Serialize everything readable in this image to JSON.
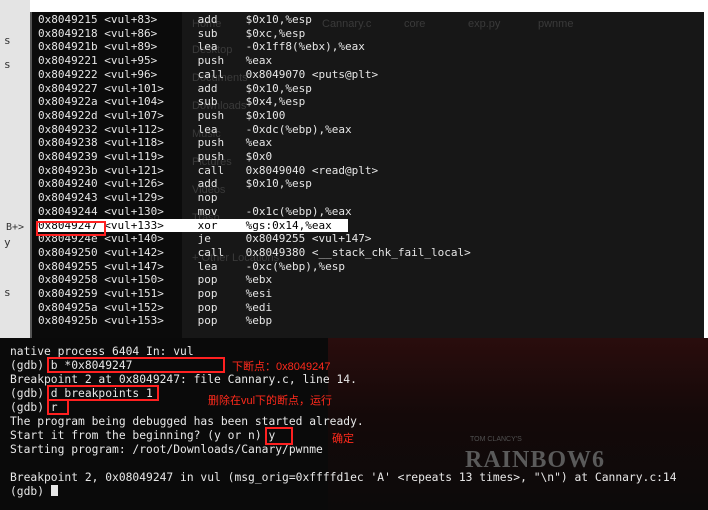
{
  "left_strip": [
    "s",
    "s",
    "y",
    "s"
  ],
  "asm": {
    "breakpoint_marker": "B+>",
    "lines": [
      {
        "addr": "0x8049215",
        "off": "<vul+83>",
        "op": "add",
        "args": "$0x10,%esp"
      },
      {
        "addr": "0x8049218",
        "off": "<vul+86>",
        "op": "sub",
        "args": "$0xc,%esp"
      },
      {
        "addr": "0x804921b",
        "off": "<vul+89>",
        "op": "lea",
        "args": "-0x1ff8(%ebx),%eax"
      },
      {
        "addr": "0x8049221",
        "off": "<vul+95>",
        "op": "push",
        "args": "%eax"
      },
      {
        "addr": "0x8049222",
        "off": "<vul+96>",
        "op": "call",
        "args": "0x8049070 <puts@plt>"
      },
      {
        "addr": "0x8049227",
        "off": "<vul+101>",
        "op": "add",
        "args": "$0x10,%esp"
      },
      {
        "addr": "0x804922a",
        "off": "<vul+104>",
        "op": "sub",
        "args": "$0x4,%esp"
      },
      {
        "addr": "0x804922d",
        "off": "<vul+107>",
        "op": "push",
        "args": "$0x100"
      },
      {
        "addr": "0x8049232",
        "off": "<vul+112>",
        "op": "lea",
        "args": "-0xdc(%ebp),%eax"
      },
      {
        "addr": "0x8049238",
        "off": "<vul+118>",
        "op": "push",
        "args": "%eax"
      },
      {
        "addr": "0x8049239",
        "off": "<vul+119>",
        "op": "push",
        "args": "$0x0"
      },
      {
        "addr": "0x804923b",
        "off": "<vul+121>",
        "op": "call",
        "args": "0x8049040 <read@plt>"
      },
      {
        "addr": "0x8049240",
        "off": "<vul+126>",
        "op": "add",
        "args": "$0x10,%esp"
      },
      {
        "addr": "0x8049243",
        "off": "<vul+129>",
        "op": "nop",
        "args": ""
      },
      {
        "addr": "0x8049244",
        "off": "<vul+130>",
        "op": "mov",
        "args": "-0x1c(%ebp),%eax"
      },
      {
        "addr": "0x8049247",
        "off": "<vul+133>",
        "op": "xor",
        "args": "%gs:0x14,%eax"
      },
      {
        "addr": "0x804924e",
        "off": "<vul+140>",
        "op": "je",
        "args": "0x8049255 <vul+147>"
      },
      {
        "addr": "0x8049250",
        "off": "<vul+142>",
        "op": "call",
        "args": "0x8049380 <__stack_chk_fail_local>"
      },
      {
        "addr": "0x8049255",
        "off": "<vul+147>",
        "op": "lea",
        "args": "-0xc(%ebp),%esp"
      },
      {
        "addr": "0x8049258",
        "off": "<vul+150>",
        "op": "pop",
        "args": "%ebx"
      },
      {
        "addr": "0x8049259",
        "off": "<vul+151>",
        "op": "pop",
        "args": "%esi"
      },
      {
        "addr": "0x804925a",
        "off": "<vul+152>",
        "op": "pop",
        "args": "%edi"
      },
      {
        "addr": "0x804925b",
        "off": "<vul+153>",
        "op": "pop",
        "args": "%ebp"
      }
    ]
  },
  "ghost_desktop": {
    "files": [
      "Cannary.c",
      "core",
      "exp.py",
      "pwnme"
    ],
    "sidebar": [
      "Home",
      "Desktop",
      "Documents",
      "Downloads",
      "Music",
      "Pictures",
      "Videos",
      "Trash",
      "+ Other Locations"
    ]
  },
  "terminal": {
    "lines": [
      "native process 6404 In: vul",
      "(gdb) b *0x8049247",
      "Breakpoint 2 at 0x8049247: file Cannary.c, line 14.",
      "(gdb) d breakpoints 1",
      "(gdb) r",
      "The program being debugged has been started already.",
      "Start it from the beginning? (y or n) y",
      "Starting program: /root/Downloads/Canary/pwnme",
      "",
      "Breakpoint 2, 0x08049247 in vul (msg_orig=0xffffd1ec 'A' <repeats 13 times>, \"\\n\") at Cannary.c:14",
      "(gdb) "
    ],
    "background_text": "RAINBOW6",
    "background_subtext": "TOM CLANCY'S"
  },
  "annotations": {
    "set_breakpoint": "下断点：0x8049247",
    "delete_breakpoint_run": "删除在vul下的断点，运行",
    "confirm": "确定"
  },
  "colors": {
    "highlight": "#ffffff",
    "annotation": "#ff2020",
    "terminal_bg": "#0a0a0a"
  }
}
